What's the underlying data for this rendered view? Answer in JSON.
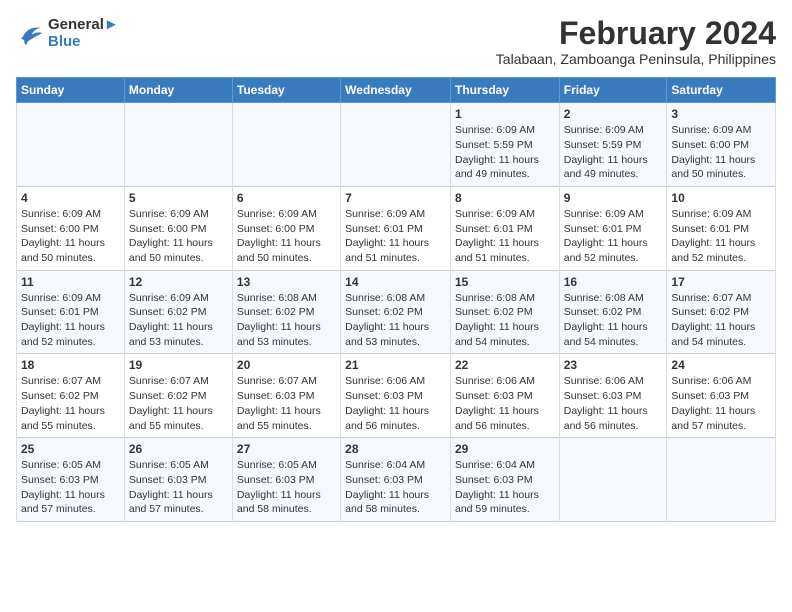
{
  "logo": {
    "line1": "General",
    "line2": "Blue"
  },
  "title": "February 2024",
  "subtitle": "Talabaan, Zamboanga Peninsula, Philippines",
  "header_days": [
    "Sunday",
    "Monday",
    "Tuesday",
    "Wednesday",
    "Thursday",
    "Friday",
    "Saturday"
  ],
  "weeks": [
    [
      {
        "day": "",
        "detail": ""
      },
      {
        "day": "",
        "detail": ""
      },
      {
        "day": "",
        "detail": ""
      },
      {
        "day": "",
        "detail": ""
      },
      {
        "day": "1",
        "detail": "Sunrise: 6:09 AM\nSunset: 5:59 PM\nDaylight: 11 hours\nand 49 minutes."
      },
      {
        "day": "2",
        "detail": "Sunrise: 6:09 AM\nSunset: 5:59 PM\nDaylight: 11 hours\nand 49 minutes."
      },
      {
        "day": "3",
        "detail": "Sunrise: 6:09 AM\nSunset: 6:00 PM\nDaylight: 11 hours\nand 50 minutes."
      }
    ],
    [
      {
        "day": "4",
        "detail": "Sunrise: 6:09 AM\nSunset: 6:00 PM\nDaylight: 11 hours\nand 50 minutes."
      },
      {
        "day": "5",
        "detail": "Sunrise: 6:09 AM\nSunset: 6:00 PM\nDaylight: 11 hours\nand 50 minutes."
      },
      {
        "day": "6",
        "detail": "Sunrise: 6:09 AM\nSunset: 6:00 PM\nDaylight: 11 hours\nand 50 minutes."
      },
      {
        "day": "7",
        "detail": "Sunrise: 6:09 AM\nSunset: 6:01 PM\nDaylight: 11 hours\nand 51 minutes."
      },
      {
        "day": "8",
        "detail": "Sunrise: 6:09 AM\nSunset: 6:01 PM\nDaylight: 11 hours\nand 51 minutes."
      },
      {
        "day": "9",
        "detail": "Sunrise: 6:09 AM\nSunset: 6:01 PM\nDaylight: 11 hours\nand 52 minutes."
      },
      {
        "day": "10",
        "detail": "Sunrise: 6:09 AM\nSunset: 6:01 PM\nDaylight: 11 hours\nand 52 minutes."
      }
    ],
    [
      {
        "day": "11",
        "detail": "Sunrise: 6:09 AM\nSunset: 6:01 PM\nDaylight: 11 hours\nand 52 minutes."
      },
      {
        "day": "12",
        "detail": "Sunrise: 6:09 AM\nSunset: 6:02 PM\nDaylight: 11 hours\nand 53 minutes."
      },
      {
        "day": "13",
        "detail": "Sunrise: 6:08 AM\nSunset: 6:02 PM\nDaylight: 11 hours\nand 53 minutes."
      },
      {
        "day": "14",
        "detail": "Sunrise: 6:08 AM\nSunset: 6:02 PM\nDaylight: 11 hours\nand 53 minutes."
      },
      {
        "day": "15",
        "detail": "Sunrise: 6:08 AM\nSunset: 6:02 PM\nDaylight: 11 hours\nand 54 minutes."
      },
      {
        "day": "16",
        "detail": "Sunrise: 6:08 AM\nSunset: 6:02 PM\nDaylight: 11 hours\nand 54 minutes."
      },
      {
        "day": "17",
        "detail": "Sunrise: 6:07 AM\nSunset: 6:02 PM\nDaylight: 11 hours\nand 54 minutes."
      }
    ],
    [
      {
        "day": "18",
        "detail": "Sunrise: 6:07 AM\nSunset: 6:02 PM\nDaylight: 11 hours\nand 55 minutes."
      },
      {
        "day": "19",
        "detail": "Sunrise: 6:07 AM\nSunset: 6:02 PM\nDaylight: 11 hours\nand 55 minutes."
      },
      {
        "day": "20",
        "detail": "Sunrise: 6:07 AM\nSunset: 6:03 PM\nDaylight: 11 hours\nand 55 minutes."
      },
      {
        "day": "21",
        "detail": "Sunrise: 6:06 AM\nSunset: 6:03 PM\nDaylight: 11 hours\nand 56 minutes."
      },
      {
        "day": "22",
        "detail": "Sunrise: 6:06 AM\nSunset: 6:03 PM\nDaylight: 11 hours\nand 56 minutes."
      },
      {
        "day": "23",
        "detail": "Sunrise: 6:06 AM\nSunset: 6:03 PM\nDaylight: 11 hours\nand 56 minutes."
      },
      {
        "day": "24",
        "detail": "Sunrise: 6:06 AM\nSunset: 6:03 PM\nDaylight: 11 hours\nand 57 minutes."
      }
    ],
    [
      {
        "day": "25",
        "detail": "Sunrise: 6:05 AM\nSunset: 6:03 PM\nDaylight: 11 hours\nand 57 minutes."
      },
      {
        "day": "26",
        "detail": "Sunrise: 6:05 AM\nSunset: 6:03 PM\nDaylight: 11 hours\nand 57 minutes."
      },
      {
        "day": "27",
        "detail": "Sunrise: 6:05 AM\nSunset: 6:03 PM\nDaylight: 11 hours\nand 58 minutes."
      },
      {
        "day": "28",
        "detail": "Sunrise: 6:04 AM\nSunset: 6:03 PM\nDaylight: 11 hours\nand 58 minutes."
      },
      {
        "day": "29",
        "detail": "Sunrise: 6:04 AM\nSunset: 6:03 PM\nDaylight: 11 hours\nand 59 minutes."
      },
      {
        "day": "",
        "detail": ""
      },
      {
        "day": "",
        "detail": ""
      }
    ]
  ]
}
